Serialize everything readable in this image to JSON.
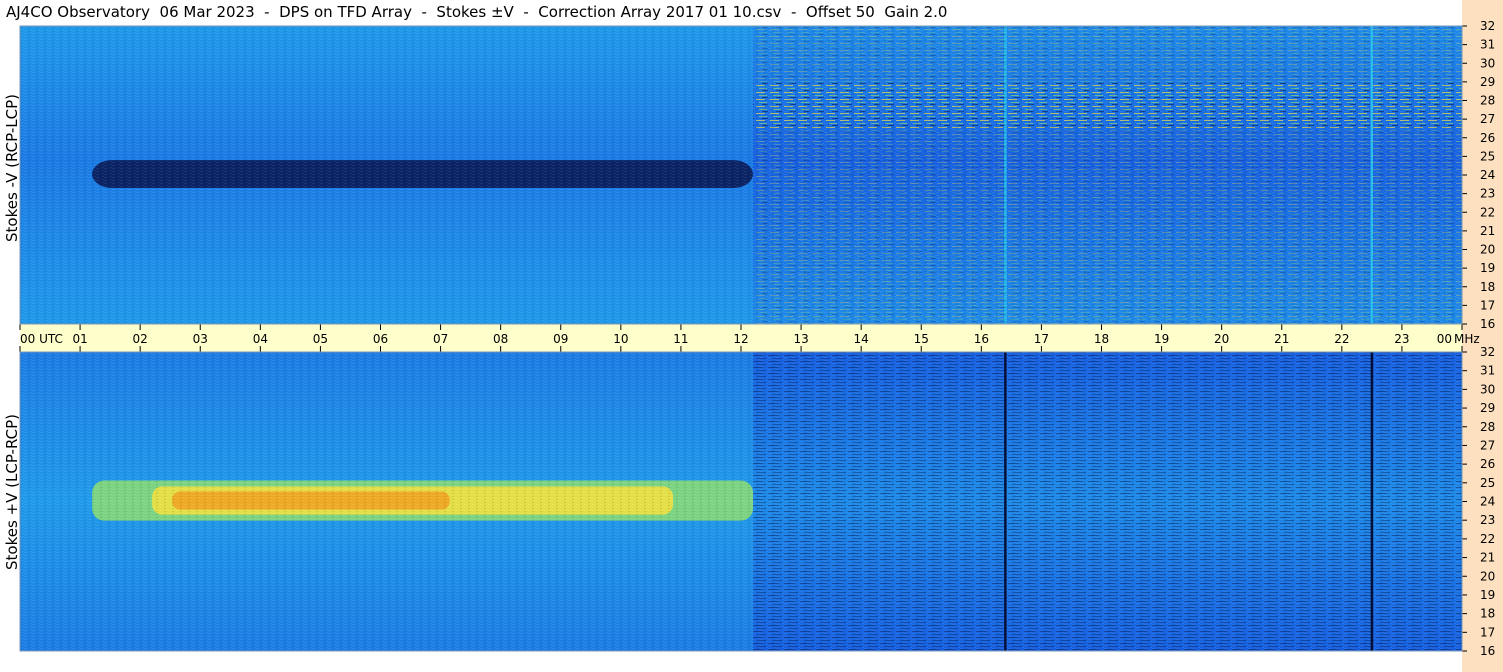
{
  "title": "AJ4CO Observatory  06 Mar 2023  -  DPS on TFD Array  -  Stokes ±V  -  Correction Array 2017 01 10.csv  -  Offset 50  Gain 2.0",
  "panels": [
    {
      "ylabel": "Stokes -V (RCP-LCP)"
    },
    {
      "ylabel": "Stokes +V (LCP-RCP)"
    }
  ],
  "colors": {
    "page_bg": "#ffffff",
    "right_band": "#fde0c0",
    "time_band": "#ffffcc",
    "map_deep": "#0a1c5a",
    "map_blue": "#1760e0",
    "map_mid": "#1e8ae8",
    "map_cyan": "#28c0f0",
    "map_green": "#9be860",
    "map_yellow": "#f0e040",
    "map_orange": "#f0a020"
  },
  "chart_data": [
    {
      "type": "heatmap",
      "title": "Stokes -V (RCP-LCP)",
      "xlabel": "UTC",
      "ylabel": "MHz",
      "x_ticks": [
        "00",
        "01",
        "02",
        "03",
        "04",
        "05",
        "06",
        "07",
        "08",
        "09",
        "10",
        "11",
        "12",
        "13",
        "14",
        "15",
        "16",
        "17",
        "18",
        "19",
        "20",
        "21",
        "22",
        "23",
        "00"
      ],
      "y_ticks": [
        "16",
        "17",
        "18",
        "19",
        "20",
        "21",
        "22",
        "23",
        "24",
        "25",
        "26",
        "27",
        "28",
        "29",
        "30",
        "31",
        "32"
      ],
      "xlim": [
        0,
        24
      ],
      "ylim": [
        16,
        32
      ],
      "features": [
        {
          "desc": "dark absorption band",
          "x": [
            1.2,
            12.2
          ],
          "y": [
            23.3,
            24.8
          ],
          "value": "low"
        },
        {
          "desc": "strong interference above",
          "x": [
            12.2,
            24
          ],
          "y": [
            26.5,
            29
          ],
          "value": "high"
        },
        {
          "desc": "vertical line",
          "x": [
            16.4,
            16.4
          ]
        },
        {
          "desc": "vertical line",
          "x": [
            22.5,
            22.5
          ]
        }
      ]
    },
    {
      "type": "heatmap",
      "title": "Stokes +V (LCP-RCP)",
      "xlabel": "UTC",
      "ylabel": "MHz",
      "x_ticks": [
        "00",
        "01",
        "02",
        "03",
        "04",
        "05",
        "06",
        "07",
        "08",
        "09",
        "10",
        "11",
        "12",
        "13",
        "14",
        "15",
        "16",
        "17",
        "18",
        "19",
        "20",
        "21",
        "22",
        "23",
        "00"
      ],
      "y_ticks": [
        "16",
        "17",
        "18",
        "19",
        "20",
        "21",
        "22",
        "23",
        "24",
        "25",
        "26",
        "27",
        "28",
        "29",
        "30",
        "31",
        "32"
      ],
      "xlim": [
        0,
        24
      ],
      "ylim": [
        16,
        32
      ],
      "features": [
        {
          "desc": "bright emission band",
          "x": [
            1.2,
            12.2
          ],
          "y": [
            23.3,
            24.8
          ],
          "value": "high"
        },
        {
          "desc": "dark vertical line",
          "x": [
            16.4,
            16.4
          ]
        },
        {
          "desc": "dark vertical line",
          "x": [
            22.5,
            22.5
          ]
        }
      ]
    }
  ],
  "time_axis": {
    "labels": [
      "00  UTC",
      "01",
      "02",
      "03",
      "04",
      "05",
      "06",
      "07",
      "08",
      "09",
      "10",
      "11",
      "12",
      "13",
      "14",
      "15",
      "16",
      "17",
      "18",
      "19",
      "20",
      "21",
      "22",
      "23",
      "00"
    ],
    "unit": "MHz"
  },
  "freq_axis": {
    "labels": [
      "16",
      "17",
      "18",
      "19",
      "20",
      "21",
      "22",
      "23",
      "24",
      "25",
      "26",
      "27",
      "28",
      "29",
      "30",
      "31",
      "32"
    ]
  }
}
